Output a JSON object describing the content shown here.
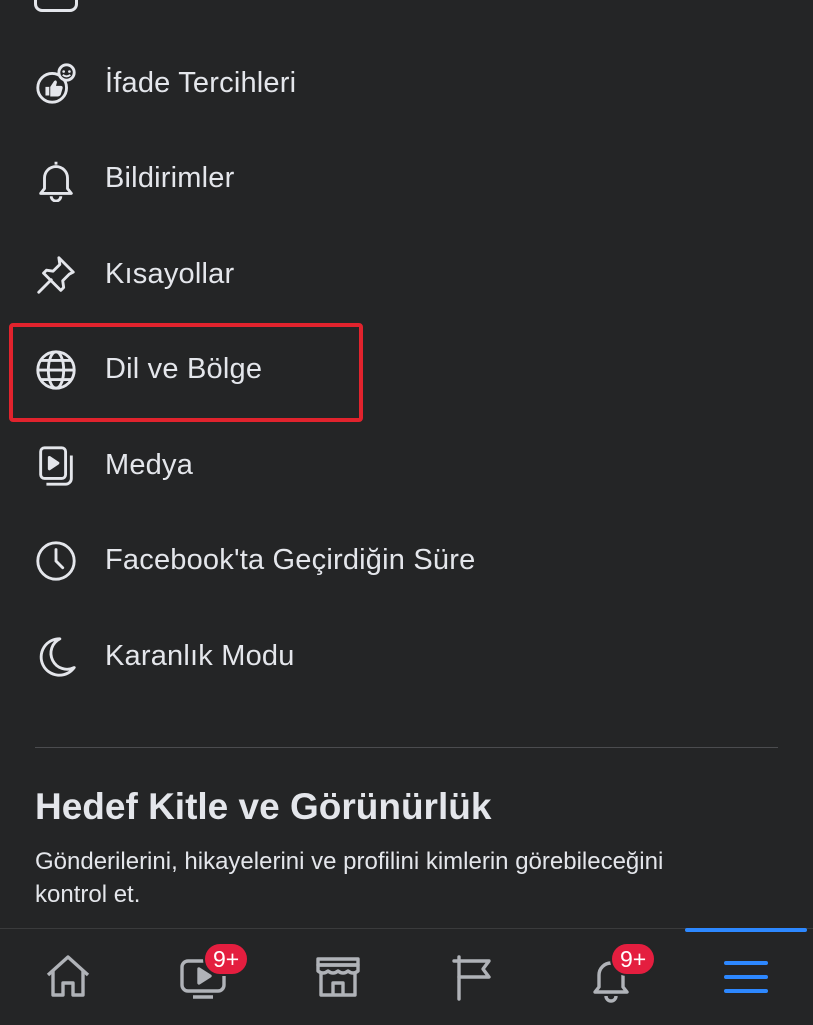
{
  "menu": {
    "items": [
      {
        "label": "İfade Tercihleri",
        "icon": "reactions-icon"
      },
      {
        "label": "Bildirimler",
        "icon": "bell-icon"
      },
      {
        "label": "Kısayollar",
        "icon": "pin-icon"
      },
      {
        "label": "Dil ve Bölge",
        "icon": "globe-icon",
        "highlighted": true
      },
      {
        "label": "Medya",
        "icon": "media-icon"
      },
      {
        "label": "Facebook'ta Geçirdiğin Süre",
        "icon": "clock-icon"
      },
      {
        "label": "Karanlık Modu",
        "icon": "moon-icon"
      }
    ]
  },
  "section": {
    "title": "Hedef Kitle ve Görünürlük",
    "description": "Gönderilerini, hikayelerini ve profilini kimlerin görebileceğini kontrol et."
  },
  "tab_bar": {
    "tabs": [
      {
        "name": "home",
        "icon": "home-icon"
      },
      {
        "name": "watch",
        "icon": "video-icon",
        "badge": "9+"
      },
      {
        "name": "marketplace",
        "icon": "store-icon"
      },
      {
        "name": "pages",
        "icon": "flag-icon"
      },
      {
        "name": "notifications",
        "icon": "bell-icon",
        "badge": "9+"
      },
      {
        "name": "menu",
        "icon": "hamburger-menu-icon",
        "active": true
      }
    ]
  },
  "colors": {
    "background": "#242526",
    "text": "#e4e6eb",
    "highlight_border": "#e1232d",
    "badge": "#e41e3f",
    "active_tab": "#2d88ff"
  }
}
